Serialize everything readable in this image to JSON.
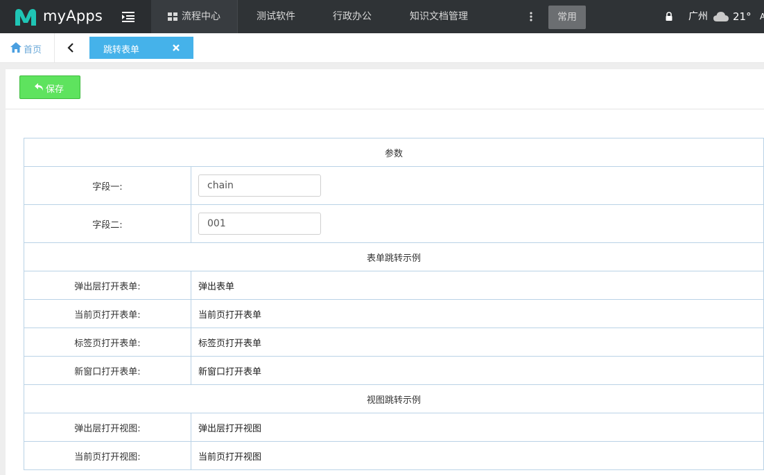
{
  "app": {
    "name": "myApps"
  },
  "nav": {
    "items": [
      "流程中心",
      "测试软件",
      "行政办公",
      "知识文档管理"
    ],
    "more": "⋮",
    "common": "常用"
  },
  "weather": {
    "city": "广州",
    "temp": "21°",
    "cut": "A"
  },
  "tabs": {
    "home": "首页",
    "active": "跳转表单"
  },
  "toolbar": {
    "save": "保存"
  },
  "form": {
    "section_params": "参数",
    "field1_label": "字段一:",
    "field1_value": "chain",
    "field2_label": "字段二:",
    "field2_value": "001",
    "section_form_jump": "表单跳转示例",
    "form_rows": [
      {
        "label": "弹出层打开表单:",
        "link": "弹出表单"
      },
      {
        "label": "当前页打开表单:",
        "link": "当前页打开表单"
      },
      {
        "label": "标签页打开表单:",
        "link": "标签页打开表单"
      },
      {
        "label": "新窗口打开表单:",
        "link": "新窗口打开表单"
      }
    ],
    "section_view_jump": "视图跳转示例",
    "view_rows": [
      {
        "label": "弹出层打开视图:",
        "link": "弹出层打开视图"
      },
      {
        "label": "当前页打开视图:",
        "link": "当前页打开视图"
      }
    ]
  },
  "colors": {
    "topbar": "#2f3336",
    "tab_active": "#45b2ea",
    "save": "#5ee35e",
    "border": "#b9d2e6"
  }
}
